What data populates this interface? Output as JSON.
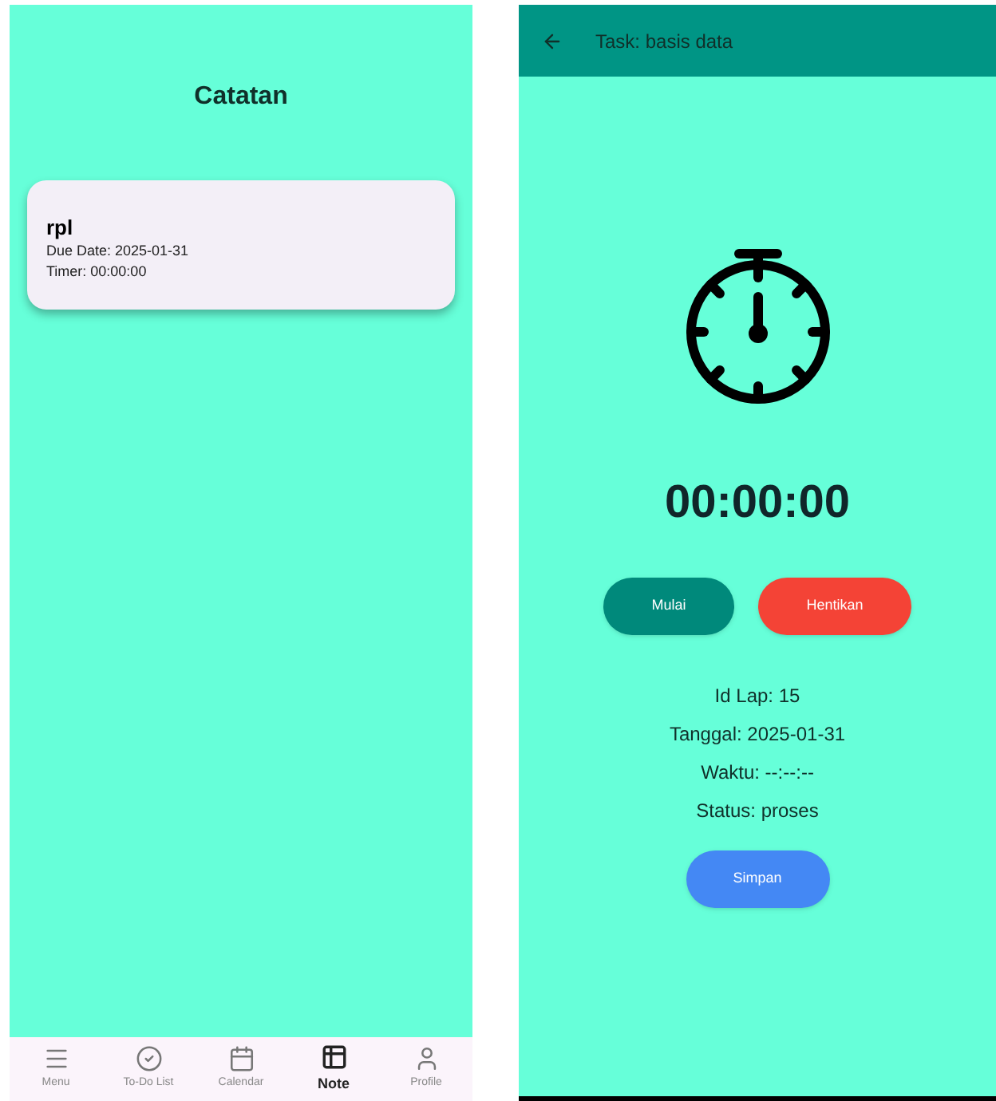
{
  "notes_screen": {
    "title": "Catatan",
    "notes": [
      {
        "name": "rpl",
        "due_date": "Due Date: 2025-01-31",
        "timer": "Timer: 00:00:00"
      }
    ],
    "bottom_nav": [
      {
        "label": "Menu",
        "kind": "menu",
        "selected": false
      },
      {
        "label": "To-Do List",
        "kind": "check",
        "selected": false
      },
      {
        "label": "Calendar",
        "kind": "calendar",
        "selected": false
      },
      {
        "label": "Note",
        "kind": "note",
        "selected": true
      },
      {
        "label": "Profile",
        "kind": "profile",
        "selected": false
      }
    ]
  },
  "task_screen": {
    "title": "Task: basis data",
    "timer": "00:00:00",
    "buttons": [
      {
        "label": "Mulai",
        "color": "#00897b"
      },
      {
        "label": "Hentikan",
        "color": "#f44336"
      }
    ],
    "details": [
      "Id Lap: 15",
      "Tanggal: 2025-01-31",
      "Waktu: --:--:--",
      "Status: proses"
    ],
    "save_button": "Simpan"
  }
}
